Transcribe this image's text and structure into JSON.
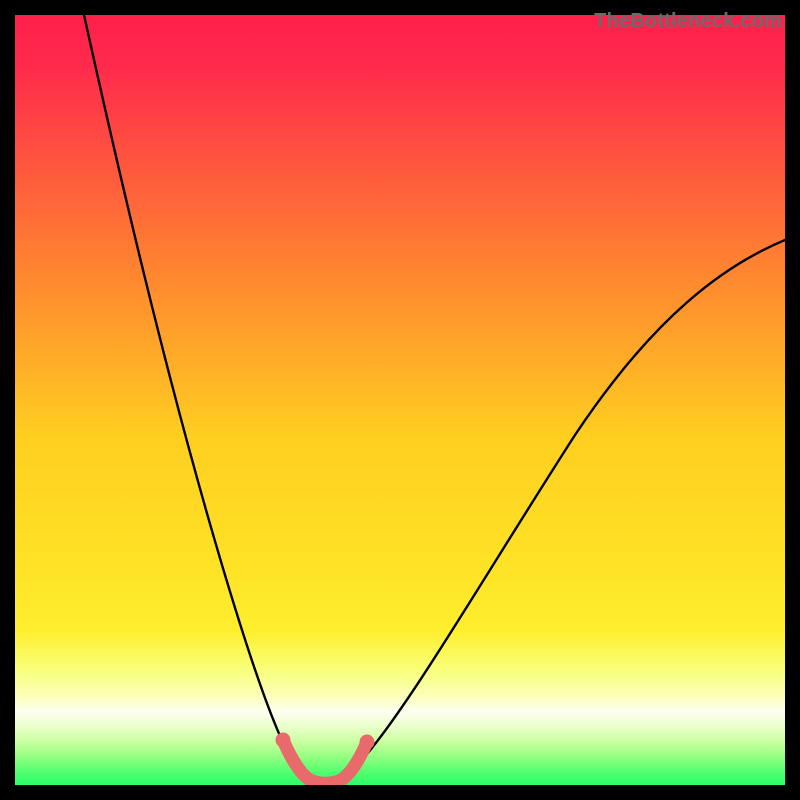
{
  "watermark": "TheBottleneck.com",
  "colors": {
    "black": "#000000",
    "curve": "#000000",
    "highlight": "#e96a6a",
    "grad_top": "#ff1f4b",
    "grad_mid1": "#ff8a2a",
    "grad_mid2": "#ffe326",
    "grad_band_a": "#f9ff7a",
    "grad_band_b": "#fdffe0",
    "grad_bottom": "#2dff6a"
  },
  "chart_data": {
    "type": "line",
    "title": "",
    "xlabel": "",
    "ylabel": "",
    "xlim": [
      0,
      100
    ],
    "ylim": [
      0,
      100
    ],
    "note": "Axis values are estimated from pixel positions; the image has no tick labels.",
    "series": [
      {
        "name": "bottleneck-curve",
        "x": [
          9,
          12,
          15,
          18,
          21,
          24,
          27,
          30,
          33,
          35,
          37,
          39,
          41,
          43,
          45,
          50,
          55,
          60,
          65,
          70,
          75,
          80,
          85,
          90,
          95,
          100
        ],
        "y": [
          100,
          90,
          80,
          70,
          60,
          50,
          40,
          30,
          20,
          12,
          6,
          2,
          0.5,
          0.5,
          2,
          7,
          14,
          22,
          30,
          38,
          46,
          53,
          59,
          64,
          68,
          71
        ]
      }
    ],
    "highlight_segment": {
      "name": "optimal-range",
      "x": [
        35,
        37,
        39,
        41,
        43,
        45
      ],
      "y": [
        12,
        6,
        2,
        0.5,
        0.5,
        2
      ]
    },
    "highlight_endpoints_visible": true
  }
}
